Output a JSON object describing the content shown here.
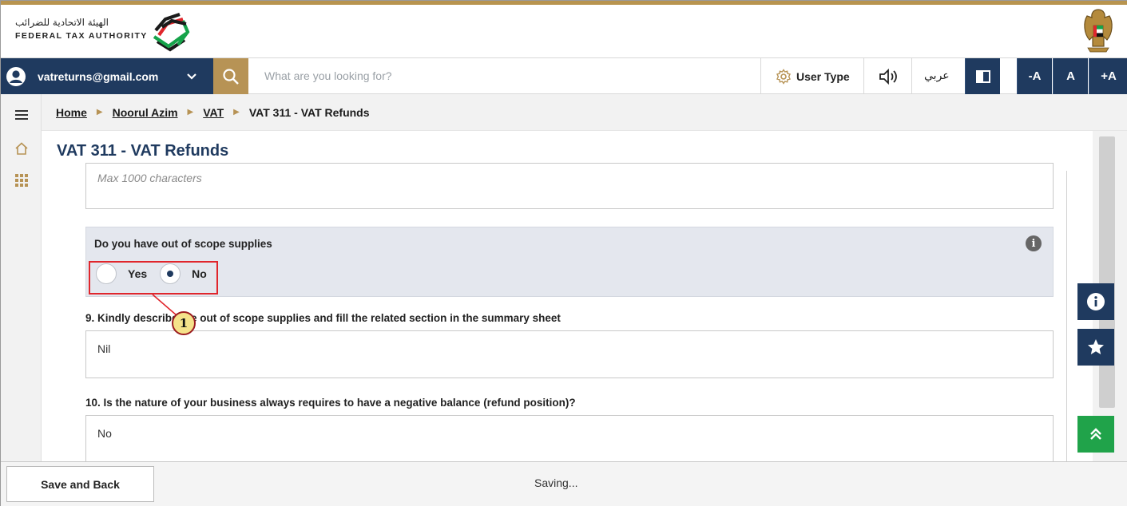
{
  "header": {
    "logo_arabic": "الهيئة الاتحادية للضرائب",
    "logo_english": "FEDERAL TAX AUTHORITY",
    "gold_color": "#b8944f"
  },
  "navbar": {
    "account_email": "vatreturns@gmail.com",
    "search_placeholder": "What are you looking for?",
    "user_type_label": "User Type",
    "language_label": "عربي",
    "font_decrease": "-A",
    "font_normal": "A",
    "font_increase": "+A",
    "navy_color": "#1f3a5f"
  },
  "breadcrumb": {
    "items": [
      "Home",
      "Noorul Azim",
      "VAT"
    ],
    "current": "VAT 311 - VAT Refunds"
  },
  "page": {
    "title": "VAT 311 - VAT Refunds",
    "prev_field_placeholder": "Max 1000 characters",
    "question_out_of_scope": "Do you have out of scope supplies",
    "radio_yes": "Yes",
    "radio_no": "No",
    "selected_option": "No",
    "q9_label": "9. Kindly describe the out of scope supplies and fill the related section in the summary sheet",
    "q9_value": "Nil",
    "q10_label": "10. Is the nature of your business always requires to have a negative balance (refund position)?",
    "q10_value": "No"
  },
  "annotation": {
    "callout_number": "1",
    "callout_color": "#e0262c"
  },
  "footer": {
    "save_back_label": "Save and Back",
    "status_text": "Saving..."
  }
}
